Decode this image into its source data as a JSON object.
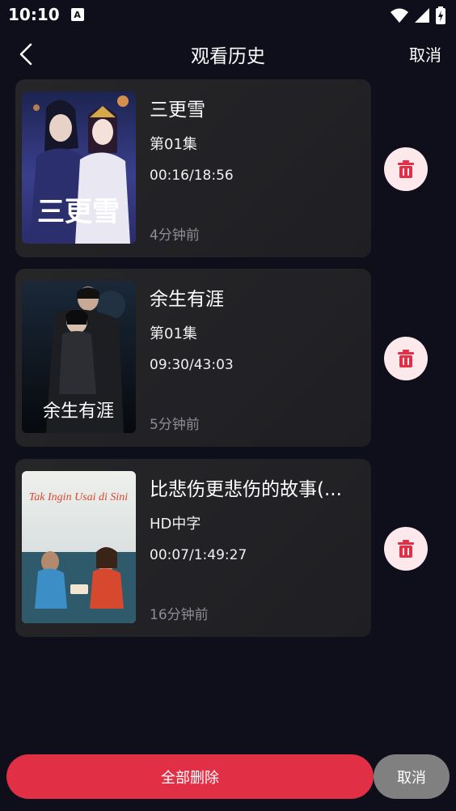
{
  "status_bar": {
    "time": "10:10",
    "notification_letter": "A",
    "icons": [
      "wifi-icon",
      "signal-icon",
      "battery-icon"
    ]
  },
  "header": {
    "back_icon": "chevron-left-icon",
    "title": "观看历史",
    "cancel_label": "取消"
  },
  "history": {
    "items": [
      {
        "title": "三更雪",
        "episode": "第01集",
        "progress": "00:16/18:56",
        "ago": "4分钟前",
        "poster_text": "三更雪"
      },
      {
        "title": "余生有涯",
        "episode": "第01集",
        "progress": "09:30/43:03",
        "ago": "5分钟前",
        "poster_text": "余生有涯"
      },
      {
        "title": "比悲伤更悲伤的故事(...",
        "episode": "HD中字",
        "progress": "00:07/1:49:27",
        "ago": "16分钟前",
        "poster_text": "Tak Ingin Usai di Sini"
      }
    ],
    "delete_icon": "trash-icon"
  },
  "bottom": {
    "delete_all_label": "全部删除",
    "cancel_label": "取消"
  },
  "colors": {
    "background": "#0f0f1c",
    "card": "#232326",
    "accent": "#e12f45",
    "delete_bg": "#fde9ec",
    "cancel_gray": "#808080"
  }
}
